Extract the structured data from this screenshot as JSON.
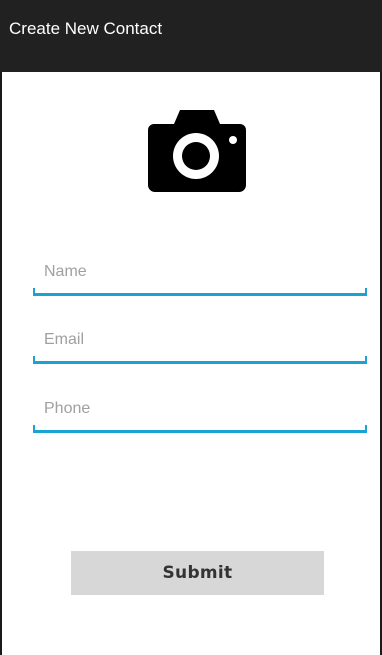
{
  "appbar": {
    "title": "Create New Contact",
    "background": "#212121"
  },
  "photo": {
    "icon": "camera-icon"
  },
  "form": {
    "name": {
      "placeholder": "Name",
      "value": ""
    },
    "email": {
      "placeholder": "Email",
      "value": ""
    },
    "phone": {
      "placeholder": "Phone",
      "value": ""
    },
    "accent_color": "#1aa3d1"
  },
  "actions": {
    "submit_label": "Submit"
  }
}
